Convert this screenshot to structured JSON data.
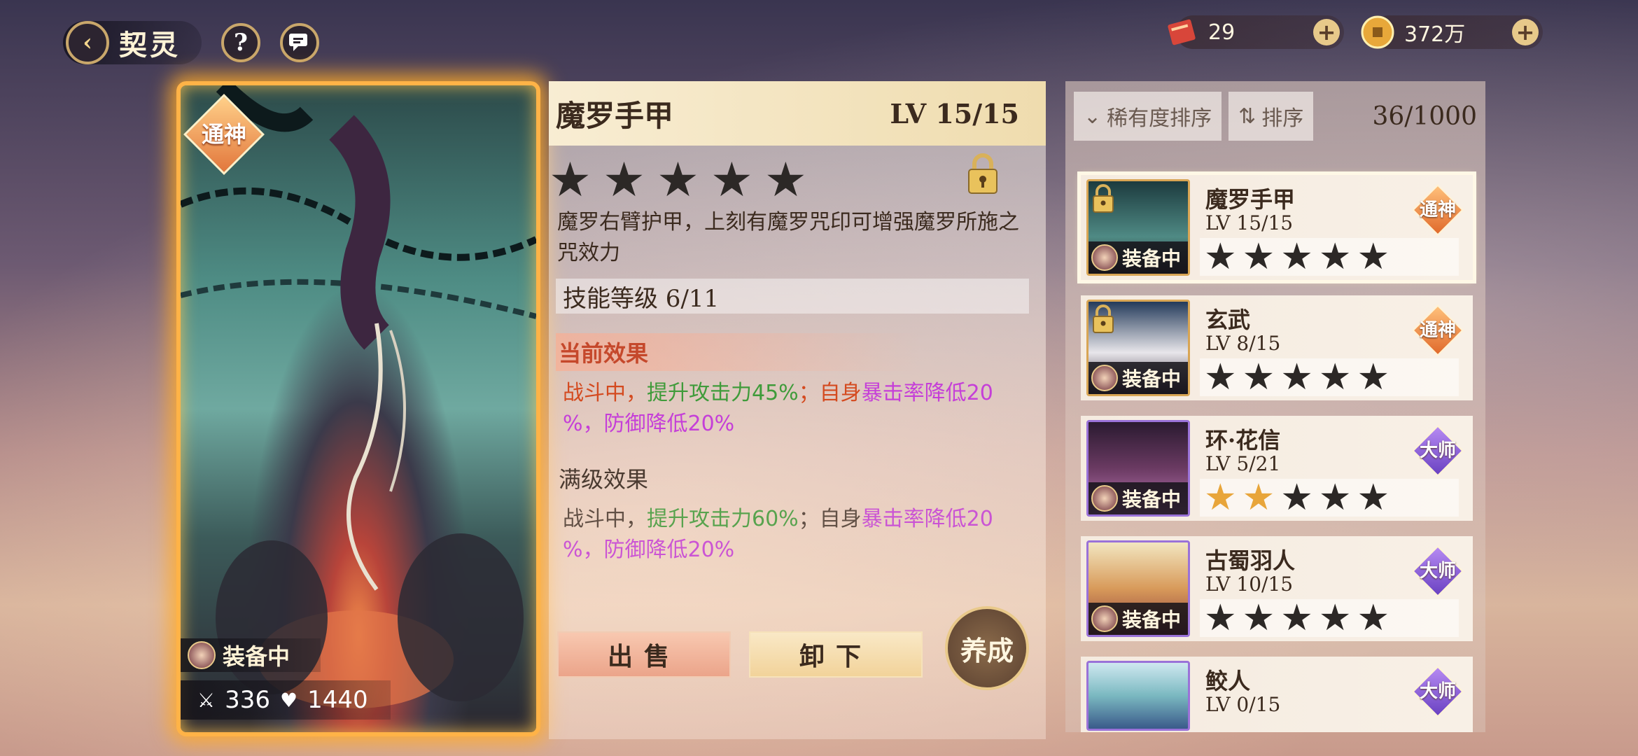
{
  "header": {
    "title": "契灵",
    "help_label": "?"
  },
  "currency": [
    {
      "icon": "scroll-ticket-icon",
      "value": "29"
    },
    {
      "icon": "gold-coin-icon",
      "value": "372万"
    }
  ],
  "card": {
    "badge": "通神",
    "equipped_label": "装备中",
    "attack": "336",
    "hp": "1440"
  },
  "detail": {
    "name": "魔罗手甲",
    "level": "LV 15/15",
    "stars_filled": 0,
    "stars_total": 5,
    "locked": true,
    "description": "魔罗右臂护甲，上刻有魔罗咒印可增强魔罗所施之咒效力",
    "skill_level": "技能等级 6/11",
    "current_effect_title": "当前效果",
    "current_effect": {
      "p1": "战斗中，",
      "p2": "提升攻击力45%",
      "p3": "；自身",
      "p4": "暴击率降低20",
      "p5": "%，防御降低20%"
    },
    "max_effect_title": "满级效果",
    "max_effect": {
      "p1": "战斗中，",
      "p2": "提升攻击力60%",
      "p3": "；自身",
      "p4": "暴击率降低20",
      "p5": "%，防御降低20%"
    },
    "buttons": {
      "sell": "出售",
      "unequip": "卸下",
      "train": "养成"
    }
  },
  "list": {
    "sort_rarity": "稀有度排序",
    "sort": "排序",
    "count": "36/1000",
    "items": [
      {
        "name": "魔罗手甲",
        "level": "LV 15/15",
        "rank": "通神",
        "stars": 0,
        "equipped": "装备中",
        "locked": true
      },
      {
        "name": "玄武",
        "level": "LV 8/15",
        "rank": "通神",
        "stars": 0,
        "equipped": "装备中",
        "locked": true
      },
      {
        "name": "环·花信",
        "level": "LV 5/21",
        "rank": "大师",
        "stars": 2,
        "equipped": "装备中",
        "locked": false
      },
      {
        "name": "古蜀羽人",
        "level": "LV 10/15",
        "rank": "大师",
        "stars": 0,
        "equipped": "装备中",
        "locked": false
      },
      {
        "name": "鲛人",
        "level": "LV 0/15",
        "rank": "大师",
        "stars": 0,
        "equipped": "",
        "locked": false
      }
    ]
  },
  "colors": {
    "gold_border": "#ffb347",
    "tier_god": "#e06a2c",
    "tier_master": "#6a42c2",
    "effect_green": "#3f9b3a",
    "effect_purple": "#c53fd8"
  }
}
